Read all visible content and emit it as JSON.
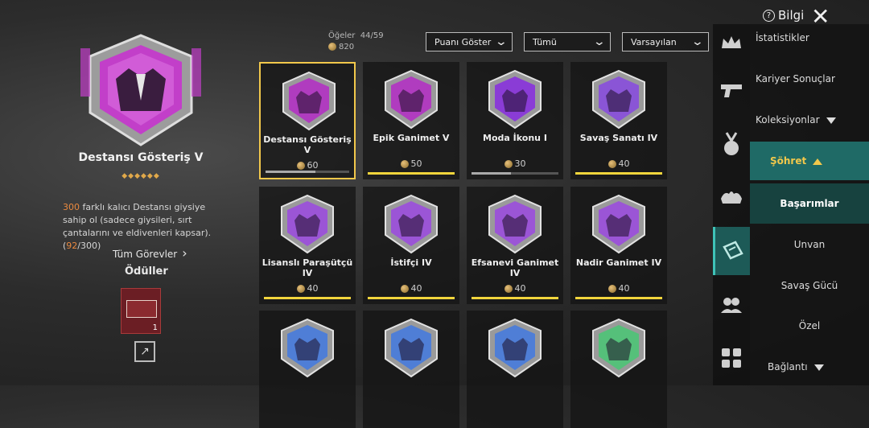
{
  "header": {
    "info_label": "Bilgi",
    "items_label": "Öğeler",
    "items_count": "44/59",
    "points_total": "820"
  },
  "filters": [
    {
      "label": "Puanı Göster"
    },
    {
      "label": "Tümü"
    },
    {
      "label": "Varsayılan"
    }
  ],
  "detail": {
    "title": "Destansı Gösteriş V",
    "stars": "◆◆◆◆◆◆",
    "desc_count": "300",
    "desc_text": " farklı kalıcı Destansı giysiye sahip ol (sadece giysileri, sırt çantalarını ve eldivenleri kapsar). (",
    "progress_current": "92",
    "progress_total": "/300)",
    "all_tasks": "Tüm Görevler",
    "rewards_title": "Ödüller",
    "reward_count": "1"
  },
  "achievements": [
    {
      "name": "Destansı Gösteriş V",
      "points": "60",
      "progress": 0.6,
      "color": "#b03cbf",
      "complete": false,
      "selected": true
    },
    {
      "name": "Epik Ganimet V",
      "points": "50",
      "progress": 1.0,
      "color": "#b03cbf",
      "complete": true
    },
    {
      "name": "Moda İkonu I",
      "points": "30",
      "progress": 0.45,
      "color": "#8a3cd6",
      "complete": false
    },
    {
      "name": "Savaş Sanatı IV",
      "points": "40",
      "progress": 1.0,
      "color": "#8a55d6",
      "complete": true
    },
    {
      "name": "Lisanslı Paraşütçü IV",
      "points": "40",
      "progress": 1.0,
      "color": "#9b55d6",
      "complete": true
    },
    {
      "name": "İstifçi IV",
      "points": "40",
      "progress": 1.0,
      "color": "#9b55d6",
      "complete": true
    },
    {
      "name": "Efsanevi Ganimet IV",
      "points": "40",
      "progress": 1.0,
      "color": "#9b55d6",
      "complete": true
    },
    {
      "name": "Nadir Ganimet IV",
      "points": "40",
      "progress": 1.0,
      "color": "#9b55d6",
      "complete": true
    },
    {
      "name": "",
      "points": "",
      "color": "#4f7ed6"
    },
    {
      "name": "",
      "points": "",
      "color": "#4f7ed6"
    },
    {
      "name": "",
      "points": "",
      "color": "#4f7ed6"
    },
    {
      "name": "",
      "points": "",
      "color": "#55c07a"
    }
  ],
  "menu": {
    "statistics": "İstatistikler",
    "career": "Kariyer Sonuçlar",
    "collections": "Koleksiyonlar",
    "fame": "Şöhret",
    "achievements": "Başarımlar",
    "title": "Unvan",
    "combat_power": "Savaş Gücü",
    "special": "Özel",
    "connection": "Bağlantı"
  },
  "colors": {
    "accent": "#f2c84b",
    "teal": "#1f6a66",
    "highlight": "#e9893f"
  }
}
